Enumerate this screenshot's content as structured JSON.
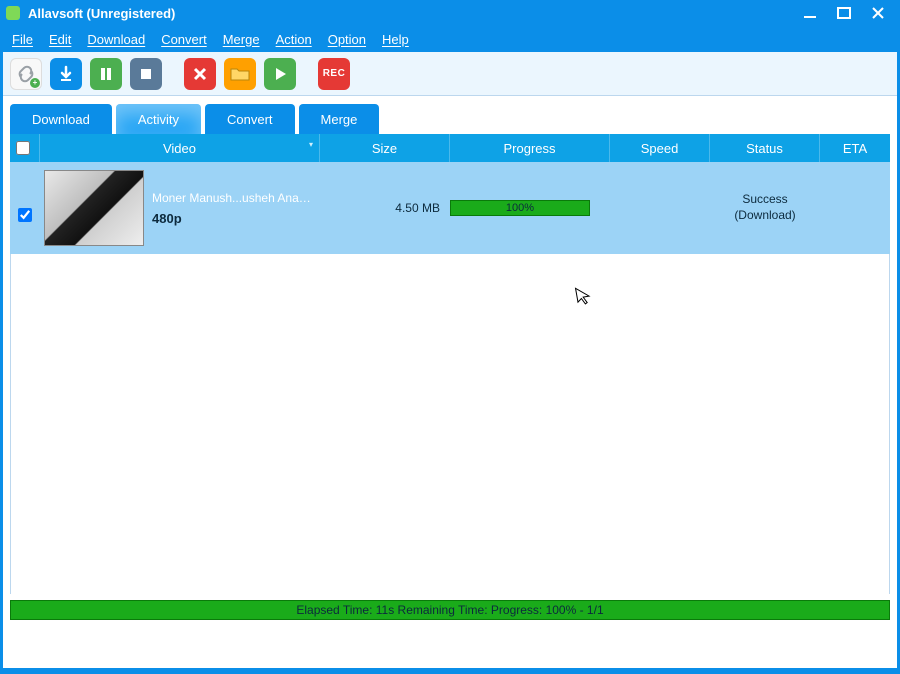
{
  "window": {
    "title": "Allavsoft (Unregistered)"
  },
  "menubar": [
    "File",
    "Edit",
    "Download",
    "Convert",
    "Merge",
    "Action",
    "Option",
    "Help"
  ],
  "toolbar": {
    "rec_label": "REC"
  },
  "tabs": {
    "download": "Download",
    "activity": "Activity",
    "convert": "Convert",
    "merge": "Merge"
  },
  "columns": {
    "video": "Video",
    "size": "Size",
    "progress": "Progress",
    "speed": "Speed",
    "status": "Status",
    "eta": "ETA"
  },
  "rows": [
    {
      "checked": true,
      "name": "Moner Manush...usheh AnadiL",
      "quality": "480p",
      "size": "4.50 MB",
      "progress_pct": "100%",
      "speed": "",
      "status_line1": "Success",
      "status_line2": "(Download)",
      "eta": ""
    }
  ],
  "statusbar": "Elapsed Time: 11s Remaining Time:  Progress: 100% - 1/1"
}
